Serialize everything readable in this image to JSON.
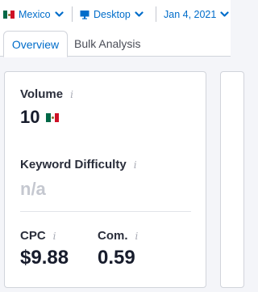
{
  "filters": {
    "country": "Mexico",
    "device": "Desktop",
    "date": "Jan 4, 2021"
  },
  "tabs": [
    "Overview",
    "Bulk Analysis"
  ],
  "metrics": {
    "volume": {
      "label": "Volume",
      "value": "10"
    },
    "keyword_difficulty": {
      "label": "Keyword Difficulty",
      "value": "n/a"
    },
    "cpc": {
      "label": "CPC",
      "value": "$9.88"
    },
    "competition": {
      "label": "Com.",
      "value": "0.59"
    }
  },
  "info_glyph": "i",
  "colors": {
    "accent": "#006dca",
    "flag_green": "#006847",
    "flag_white": "#ffffff",
    "flag_red": "#ce1126",
    "muted_value": "#c5c8d0"
  },
  "icons": {
    "flag": "mexico-flag-icon",
    "device": "desktop-monitor-icon",
    "dropdown": "chevron-down-icon",
    "info": "info-icon"
  }
}
